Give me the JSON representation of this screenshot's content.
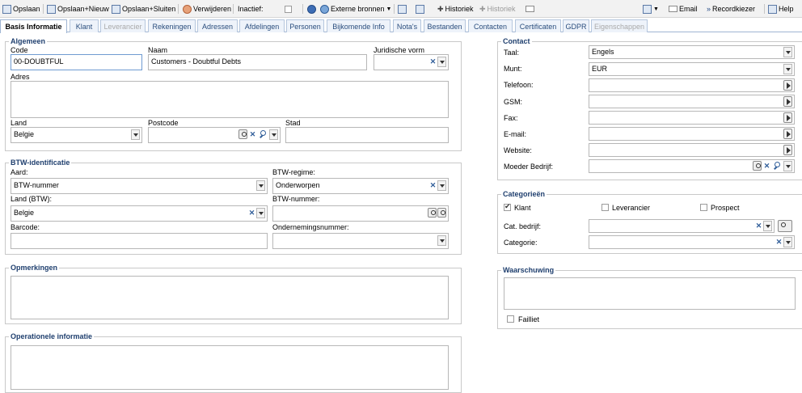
{
  "toolbar": {
    "save": "Opslaan",
    "save_new": "Opslaan+Nieuw",
    "save_close": "Opslaan+Sluiten",
    "delete": "Verwijderen",
    "inactive": "Inactief:",
    "external": "Externe bronnen",
    "history1": "Historiek",
    "history2": "Historiek",
    "email": "Email",
    "record_picker": "Recordkiezer",
    "help": "Help"
  },
  "tabs": [
    "Basis Informatie",
    "Klant",
    "Leverancier",
    "Rekeningen",
    "Adressen",
    "Afdelingen",
    "Personen",
    "Bijkomende Info",
    "Nota's",
    "Bestanden",
    "Contacten",
    "Certificaten",
    "GDPR",
    "Eigenschappen"
  ],
  "algemeen": {
    "legend": "Algemeen",
    "code_label": "Code",
    "code_value": "00-DOUBTFUL",
    "naam_label": "Naam",
    "naam_value": "Customers - Doubtful Debts",
    "jur_label": "Juridische vorm",
    "adres_label": "Adres",
    "land_label": "Land",
    "land_value": "Belgie",
    "postcode_label": "Postcode",
    "stad_label": "Stad"
  },
  "btw": {
    "legend": "BTW-identificatie",
    "aard_label": "Aard:",
    "aard_value": "BTW-nummer",
    "regime_label": "BTW-regime:",
    "regime_value": "Onderworpen",
    "land_label": "Land (BTW):",
    "land_value": "Belgie",
    "nummer_label": "BTW-nummer:",
    "barcode_label": "Barcode:",
    "onderneming_label": "Ondernemingsnummer:"
  },
  "opmerkingen": {
    "legend": "Opmerkingen"
  },
  "operationeel": {
    "legend": "Operationele informatie"
  },
  "contact": {
    "legend": "Contact",
    "taal_label": "Taal:",
    "taal_value": "Engels",
    "munt_label": "Munt:",
    "munt_value": "EUR",
    "telefoon_label": "Telefoon:",
    "gsm_label": "GSM:",
    "fax_label": "Fax:",
    "email_label": "E-mail:",
    "website_label": "Website:",
    "moeder_label": "Moeder Bedrijf:"
  },
  "categorieen": {
    "legend": "Categorieën",
    "klant": "Klant",
    "leverancier": "Leverancier",
    "prospect": "Prospect",
    "klant_checked": true,
    "cat_bedrijf_label": "Cat. bedrijf:",
    "categorie_label": "Categorie:"
  },
  "waarschuwing": {
    "legend": "Waarschuwing",
    "failliet": "Failliet"
  }
}
